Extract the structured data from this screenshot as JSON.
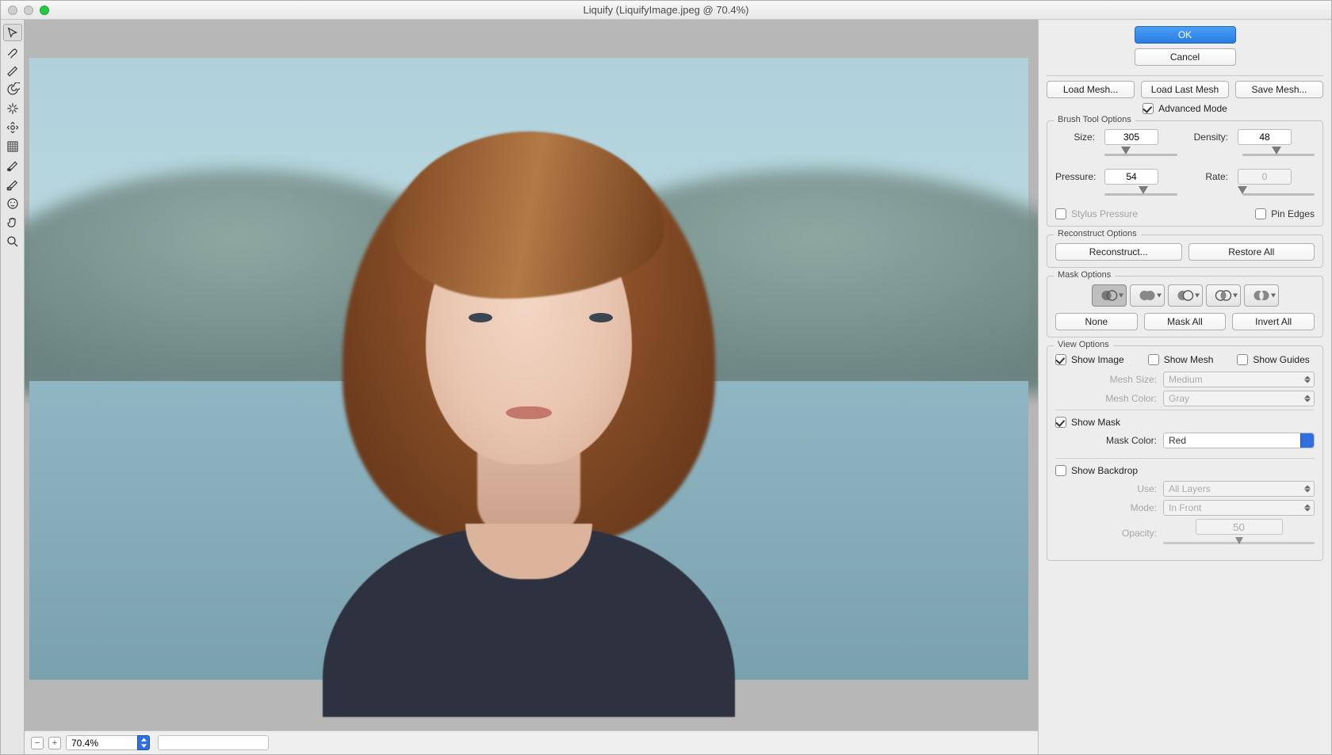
{
  "window": {
    "title": "Liquify (LiquifyImage.jpeg @ 70.4%)"
  },
  "okcancel": {
    "ok": "OK",
    "cancel": "Cancel"
  },
  "mesh_buttons": {
    "load": "Load Mesh...",
    "load_last": "Load Last Mesh",
    "save": "Save Mesh..."
  },
  "advanced_mode": {
    "label": "Advanced Mode",
    "checked": true
  },
  "brush": {
    "title": "Brush Tool Options",
    "size_label": "Size:",
    "size": "305",
    "size_pct": 30,
    "density_label": "Density:",
    "density": "48",
    "density_pct": 48,
    "pressure_label": "Pressure:",
    "pressure": "54",
    "pressure_pct": 54,
    "rate_label": "Rate:",
    "rate": "0",
    "rate_pct": 0,
    "rate_disabled": true,
    "stylus_label": "Stylus Pressure",
    "stylus_checked": false,
    "pin_label": "Pin Edges",
    "pin_checked": false
  },
  "reconstruct": {
    "title": "Reconstruct Options",
    "reconstruct": "Reconstruct...",
    "restore": "Restore All"
  },
  "mask": {
    "title": "Mask Options",
    "none": "None",
    "mask_all": "Mask All",
    "invert_all": "Invert All"
  },
  "view": {
    "title": "View Options",
    "show_image": "Show Image",
    "show_image_checked": true,
    "show_mesh": "Show Mesh",
    "show_mesh_checked": false,
    "show_guides": "Show Guides",
    "show_guides_checked": false,
    "mesh_size_label": "Mesh Size:",
    "mesh_size": "Medium",
    "mesh_color_label": "Mesh Color:",
    "mesh_color": "Gray",
    "show_mask": "Show Mask",
    "show_mask_checked": true,
    "mask_color_label": "Mask Color:",
    "mask_color": "Red",
    "show_backdrop": "Show Backdrop",
    "show_backdrop_checked": false,
    "use_label": "Use:",
    "use": "All Layers",
    "mode_label": "Mode:",
    "mode": "In Front",
    "opacity_label": "Opacity:",
    "opacity": "50"
  },
  "zoom": {
    "value": "70.4%"
  },
  "tools": [
    "forward-warp",
    "reconstruct-brush",
    "smooth",
    "twirl",
    "pucker",
    "bloat",
    "push-left",
    "freeze-mask",
    "thaw-mask",
    "face",
    "hand",
    "zoom"
  ]
}
